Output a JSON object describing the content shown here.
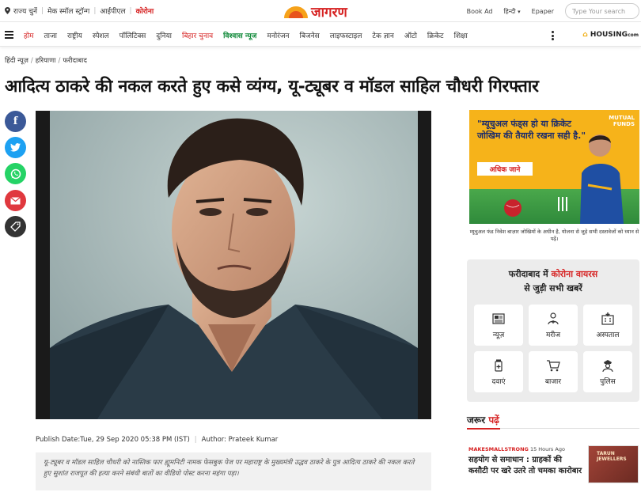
{
  "top": {
    "links": [
      "राज्य चुनें",
      "मेक स्मॉल स्ट्रॉन्ग",
      "आईपीएल",
      "कोरोना"
    ],
    "logo_text": "जागरण",
    "right_links": [
      "Book Ad",
      "हिन्दी",
      "Epaper"
    ],
    "search_placeholder": "Type Your search"
  },
  "nav": {
    "items": [
      "होम",
      "ताजा",
      "राष्ट्रीय",
      "स्पेशल",
      "पॉलिटिक्स",
      "दुनिया",
      "बिहार चुनाव",
      "विश्वास न्यूज",
      "मनोरंजन",
      "बिजनेस",
      "लाइफस्टाइल",
      "टेक ज्ञान",
      "ऑटो",
      "क्रिकेट",
      "शिक्षा"
    ],
    "sponsor": "HOUSING",
    "sponsor_suffix": "com"
  },
  "breadcrumb": [
    "हिंदी न्यूज़",
    "हरियाणा",
    "फरीदाबाद"
  ],
  "article": {
    "title": "आदित्य ठाकरे की नकल करते हुए कसे व्यंग्य, यू-ट्यूबर व मॉडल साहिल चौधरी गिरफ्तार",
    "publish_date": "Publish Date:Tue, 29 Sep 2020 05:38 PM (IST)",
    "author": "Author: Prateek Kumar",
    "summary": "यू-ट्यूबर व मॉडल साहिल चौधरी को नास्तिक फार ह्यूमनिटी नामक फेसबुक पेज पर महाराष्ट्र के मुख्यमंत्री उद्धव ठाकरे के पुत्र आदित्य ठाकरे की नकल करते हुए सुशांत राजपूत की हत्या करने संबंधी बातों का वीडियो पोस्ट करना महंगा पड़ा।"
  },
  "share": [
    {
      "icon": "facebook-icon",
      "color": "#3b5998"
    },
    {
      "icon": "twitter-icon",
      "color": "#1da1f2"
    },
    {
      "icon": "whatsapp-icon",
      "color": "#25d366"
    },
    {
      "icon": "mail-icon",
      "color": "#e0383e"
    },
    {
      "icon": "tag-icon",
      "color": "#333333"
    }
  ],
  "ad": {
    "headline": "\"म्यूचुअल फंड्स हो या क्रिकेट जोखिम की तैयारी रखना सही है.\"",
    "cta": "अधिक जाने",
    "brand_line1": "MUTUAL",
    "brand_line2": "FUNDS",
    "disclaimer": "म्यूचुअल फंड निवेश बाज़ार जोखिमों के अधीन है, योजना से जुड़े सभी दस्तावेजों को ध्यान से पढ़ें।"
  },
  "widget": {
    "title_prefix": "फरीदाबाद में ",
    "title_highlight": "कोरोना वायरस",
    "title_line2": "से जुड़ी सभी खबरें",
    "tiles": [
      "न्यूज़",
      "मरीज",
      "अस्पताल",
      "दवाएं",
      "बाजार",
      "पुलिस"
    ]
  },
  "must_read": {
    "label_prefix": "जरूर ",
    "label_highlight": "पढ़ें",
    "source": "MAKESMALLSTRONG",
    "time": " 15 Hours Ago",
    "story_title": "सहयोग से समाधान : ग्राहकों की कसौटी पर खरे उतरे तो चमका कारोबार",
    "thumb_text": "TARUN JEWELLERS"
  },
  "colors": {
    "accent": "#d62222",
    "green": "#118a3a",
    "ad_bg": "#f6b31a"
  }
}
